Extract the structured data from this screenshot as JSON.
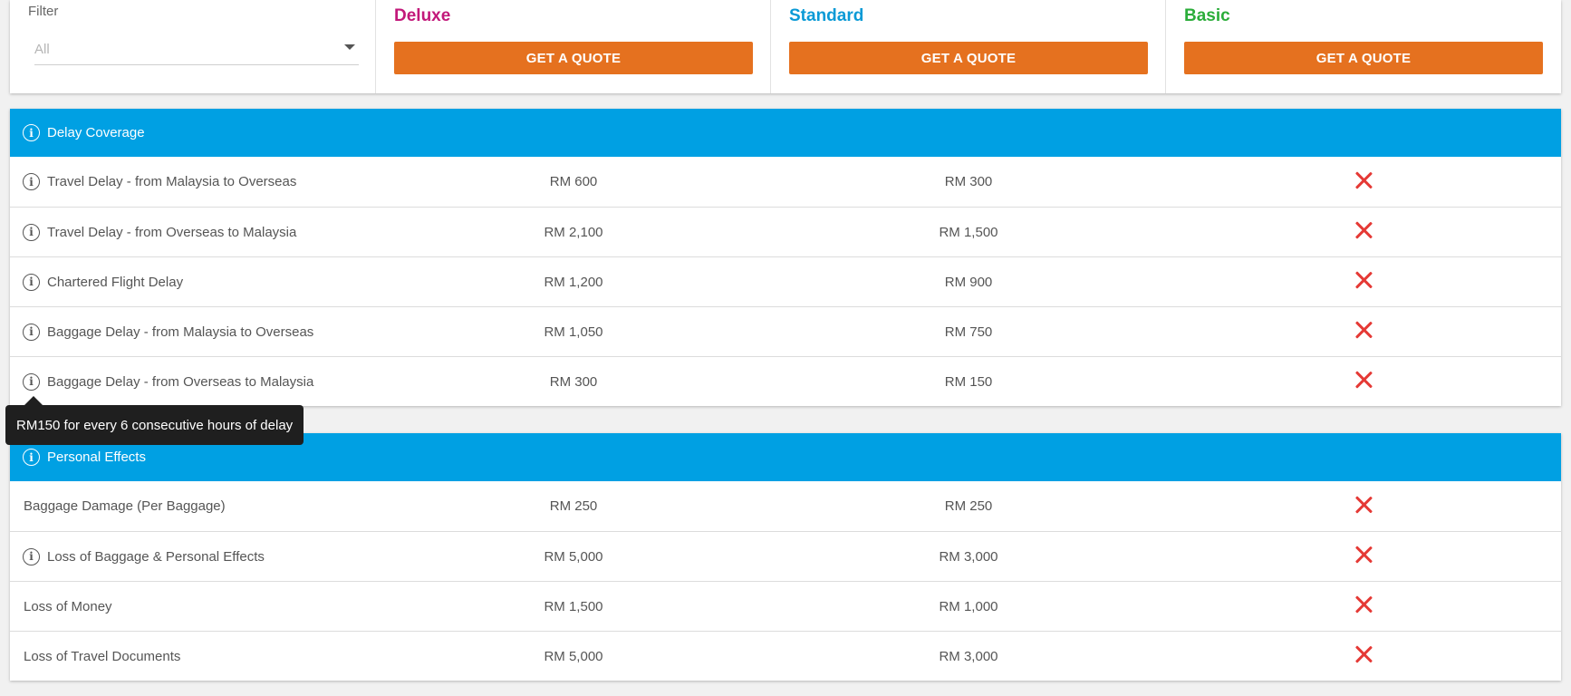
{
  "filter": {
    "label": "Filter",
    "value": "All"
  },
  "plans": [
    {
      "name": "Deluxe",
      "color": "#c2187a",
      "button": "GET A QUOTE"
    },
    {
      "name": "Standard",
      "color": "#0a9ad6",
      "button": "GET A QUOTE"
    },
    {
      "name": "Basic",
      "color": "#2bad3a",
      "button": "GET A QUOTE"
    }
  ],
  "colors": {
    "accent_blue": "#00a0e3",
    "button_orange": "#e5711f",
    "cross_red": "#e53935"
  },
  "sections": [
    {
      "title": "Delay Coverage",
      "rows": [
        {
          "label": "Travel Delay - from Malaysia to Overseas",
          "deluxe": "RM 600",
          "standard": "RM 300",
          "basic": "not-covered"
        },
        {
          "label": "Travel Delay - from Overseas to Malaysia",
          "deluxe": "RM 2,100",
          "standard": "RM 1,500",
          "basic": "not-covered"
        },
        {
          "label": "Chartered Flight Delay",
          "deluxe": "RM 1,200",
          "standard": "RM 900",
          "basic": "not-covered"
        },
        {
          "label": "Baggage Delay - from Malaysia to Overseas",
          "deluxe": "RM 1,050",
          "standard": "RM 750",
          "basic": "not-covered"
        },
        {
          "label": "Baggage Delay - from Overseas to Malaysia",
          "deluxe": "RM 300",
          "standard": "RM 150",
          "basic": "not-covered"
        }
      ]
    },
    {
      "title": "Personal Effects",
      "rows": [
        {
          "label": "Baggage Damage (Per Baggage)",
          "deluxe": "RM 250",
          "standard": "RM 250",
          "basic": "not-covered"
        },
        {
          "label": "Loss of Baggage & Personal Effects",
          "deluxe": "RM 5,000",
          "standard": "RM 3,000",
          "basic": "not-covered"
        },
        {
          "label": "Loss of Money",
          "deluxe": "RM 1,500",
          "standard": "RM 1,000",
          "basic": "not-covered"
        },
        {
          "label": "Loss of Travel Documents",
          "deluxe": "RM 5,000",
          "standard": "RM 3,000",
          "basic": "not-covered"
        }
      ]
    }
  ],
  "tooltip": {
    "text": "RM150 for every 6 consecutive hours of delay"
  },
  "icons": {
    "info": "info-circle-icon",
    "not_covered": "cross-icon",
    "dropdown": "caret-down-icon"
  }
}
